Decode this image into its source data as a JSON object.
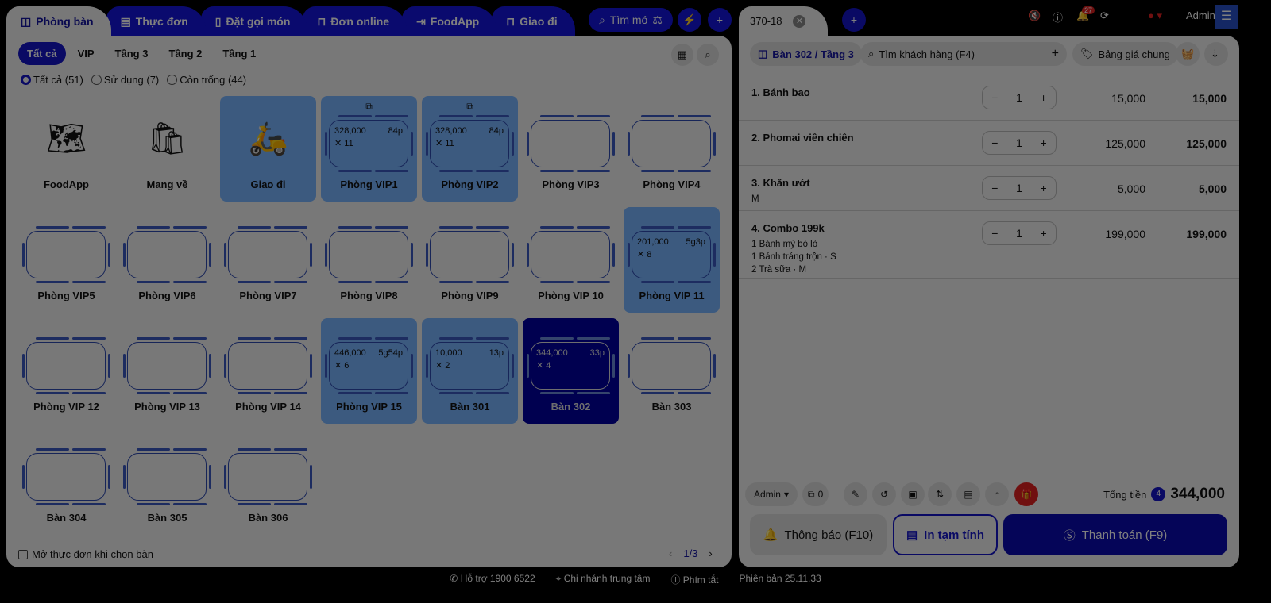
{
  "tabs": [
    {
      "label": "Phòng bàn",
      "icon": "table-icon"
    },
    {
      "label": "Thực đơn",
      "icon": "menu-icon"
    },
    {
      "label": "Đặt gọi món",
      "icon": "phone-order-icon"
    },
    {
      "label": "Đơn online",
      "icon": "bag-icon"
    },
    {
      "label": "FoodApp",
      "icon": "login-icon"
    },
    {
      "label": "Giao đi",
      "icon": "bag-icon"
    }
  ],
  "search_menu": "Tìm mó",
  "floors": [
    "Tất cả",
    "VIP",
    "Tầng 3",
    "Tầng 2",
    "Tầng 1"
  ],
  "filters": [
    "Tất cả (51)",
    "Sử dụng (7)",
    "Còn trống (44)"
  ],
  "tables": [
    {
      "name": "FoodApp",
      "kind": "icon",
      "icon": "🗺"
    },
    {
      "name": "Mang về",
      "kind": "icon",
      "icon": "🛍"
    },
    {
      "name": "Giao đi",
      "kind": "icon-used",
      "icon": "🛵"
    },
    {
      "name": "Phòng VIP1",
      "kind": "used",
      "amount": "328,000",
      "time": "84p",
      "guests": "11",
      "merged": true
    },
    {
      "name": "Phòng VIP2",
      "kind": "used",
      "amount": "328,000",
      "time": "84p",
      "guests": "11",
      "merged": true
    },
    {
      "name": "Phòng VIP3",
      "kind": "empty"
    },
    {
      "name": "Phòng VIP4",
      "kind": "empty"
    },
    {
      "name": "Phòng VIP5",
      "kind": "empty"
    },
    {
      "name": "Phòng VIP6",
      "kind": "empty"
    },
    {
      "name": "Phòng VIP7",
      "kind": "empty"
    },
    {
      "name": "Phòng VIP8",
      "kind": "empty"
    },
    {
      "name": "Phòng VIP9",
      "kind": "empty"
    },
    {
      "name": "Phòng VIP 10",
      "kind": "empty"
    },
    {
      "name": "Phòng VIP 11",
      "kind": "used",
      "amount": "201,000",
      "time": "5g3p",
      "guests": "8"
    },
    {
      "name": "Phòng VIP 12",
      "kind": "empty"
    },
    {
      "name": "Phòng VIP 13",
      "kind": "empty"
    },
    {
      "name": "Phòng VIP 14",
      "kind": "empty"
    },
    {
      "name": "Phòng VIP 15",
      "kind": "used",
      "amount": "446,000",
      "time": "5g54p",
      "guests": "6"
    },
    {
      "name": "Bàn 301",
      "kind": "used",
      "amount": "10,000",
      "time": "13p",
      "guests": "2"
    },
    {
      "name": "Bàn 302",
      "kind": "sel",
      "amount": "344,000",
      "time": "33p",
      "guests": "4"
    },
    {
      "name": "Bàn 303",
      "kind": "empty"
    },
    {
      "name": "Bàn 304",
      "kind": "empty"
    },
    {
      "name": "Bàn 305",
      "kind": "empty"
    },
    {
      "name": "Bàn 306",
      "kind": "empty"
    }
  ],
  "open_menu_label": "Mở thực đơn khi chọn bàn",
  "pagination": "1/3",
  "order": {
    "tab": "370-18",
    "table": "Bàn 302 / Tầng 3",
    "customer_placeholder": "Tìm khách hàng (F4)",
    "price_list": "Bảng giá chung",
    "items": [
      {
        "title": "1. Bánh bao",
        "sub": [],
        "qty": "1",
        "price": "15,000",
        "total": "15,000"
      },
      {
        "title": "2. Phomai viên chiên",
        "sub": [],
        "qty": "1",
        "price": "125,000",
        "total": "125,000"
      },
      {
        "title": "3. Khăn ướt",
        "sub": [
          "M"
        ],
        "qty": "1",
        "price": "5,000",
        "total": "5,000"
      },
      {
        "title": "4. Combo 199k",
        "sub": [
          "1 Bánh mỳ bỏ lò",
          "1 Bánh tráng trộn ·  S",
          "2 Trà sữa ·  M"
        ],
        "qty": "1",
        "price": "199,000",
        "total": "199,000"
      }
    ],
    "staff": "Admin",
    "guests": "0",
    "total_label": "Tổng tiền",
    "count": "4",
    "total": "344,000",
    "notify": "Thông báo (F10)",
    "print": "In tạm tính",
    "pay": "Thanh toán (F9)"
  },
  "header": {
    "notifications": "27",
    "user": "Admin"
  },
  "status": [
    "Hỗ trợ 1900 6522",
    "Chi nhánh trung tâm",
    "Phím tắt",
    "Phiên bản 25.11.33"
  ],
  "colors": {
    "brand": "#1414dc",
    "selected": "#0000a0",
    "used": "#78b4ff"
  }
}
